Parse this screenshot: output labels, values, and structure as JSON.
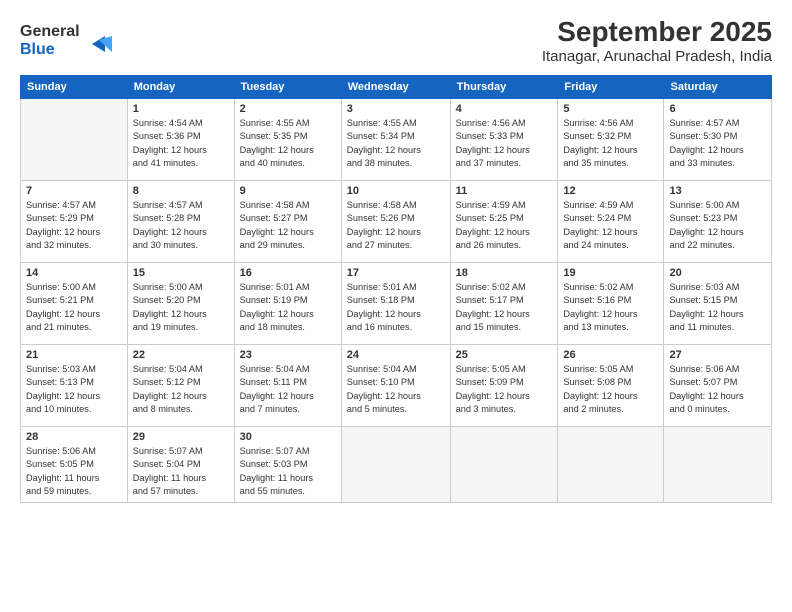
{
  "header": {
    "logo_line1": "General",
    "logo_line2": "Blue",
    "month": "September 2025",
    "location": "Itanagar, Arunachal Pradesh, India"
  },
  "days_of_week": [
    "Sunday",
    "Monday",
    "Tuesday",
    "Wednesday",
    "Thursday",
    "Friday",
    "Saturday"
  ],
  "weeks": [
    [
      {
        "num": "",
        "info": ""
      },
      {
        "num": "1",
        "info": "Sunrise: 4:54 AM\nSunset: 5:36 PM\nDaylight: 12 hours\nand 41 minutes."
      },
      {
        "num": "2",
        "info": "Sunrise: 4:55 AM\nSunset: 5:35 PM\nDaylight: 12 hours\nand 40 minutes."
      },
      {
        "num": "3",
        "info": "Sunrise: 4:55 AM\nSunset: 5:34 PM\nDaylight: 12 hours\nand 38 minutes."
      },
      {
        "num": "4",
        "info": "Sunrise: 4:56 AM\nSunset: 5:33 PM\nDaylight: 12 hours\nand 37 minutes."
      },
      {
        "num": "5",
        "info": "Sunrise: 4:56 AM\nSunset: 5:32 PM\nDaylight: 12 hours\nand 35 minutes."
      },
      {
        "num": "6",
        "info": "Sunrise: 4:57 AM\nSunset: 5:30 PM\nDaylight: 12 hours\nand 33 minutes."
      }
    ],
    [
      {
        "num": "7",
        "info": "Sunrise: 4:57 AM\nSunset: 5:29 PM\nDaylight: 12 hours\nand 32 minutes."
      },
      {
        "num": "8",
        "info": "Sunrise: 4:57 AM\nSunset: 5:28 PM\nDaylight: 12 hours\nand 30 minutes."
      },
      {
        "num": "9",
        "info": "Sunrise: 4:58 AM\nSunset: 5:27 PM\nDaylight: 12 hours\nand 29 minutes."
      },
      {
        "num": "10",
        "info": "Sunrise: 4:58 AM\nSunset: 5:26 PM\nDaylight: 12 hours\nand 27 minutes."
      },
      {
        "num": "11",
        "info": "Sunrise: 4:59 AM\nSunset: 5:25 PM\nDaylight: 12 hours\nand 26 minutes."
      },
      {
        "num": "12",
        "info": "Sunrise: 4:59 AM\nSunset: 5:24 PM\nDaylight: 12 hours\nand 24 minutes."
      },
      {
        "num": "13",
        "info": "Sunrise: 5:00 AM\nSunset: 5:23 PM\nDaylight: 12 hours\nand 22 minutes."
      }
    ],
    [
      {
        "num": "14",
        "info": "Sunrise: 5:00 AM\nSunset: 5:21 PM\nDaylight: 12 hours\nand 21 minutes."
      },
      {
        "num": "15",
        "info": "Sunrise: 5:00 AM\nSunset: 5:20 PM\nDaylight: 12 hours\nand 19 minutes."
      },
      {
        "num": "16",
        "info": "Sunrise: 5:01 AM\nSunset: 5:19 PM\nDaylight: 12 hours\nand 18 minutes."
      },
      {
        "num": "17",
        "info": "Sunrise: 5:01 AM\nSunset: 5:18 PM\nDaylight: 12 hours\nand 16 minutes."
      },
      {
        "num": "18",
        "info": "Sunrise: 5:02 AM\nSunset: 5:17 PM\nDaylight: 12 hours\nand 15 minutes."
      },
      {
        "num": "19",
        "info": "Sunrise: 5:02 AM\nSunset: 5:16 PM\nDaylight: 12 hours\nand 13 minutes."
      },
      {
        "num": "20",
        "info": "Sunrise: 5:03 AM\nSunset: 5:15 PM\nDaylight: 12 hours\nand 11 minutes."
      }
    ],
    [
      {
        "num": "21",
        "info": "Sunrise: 5:03 AM\nSunset: 5:13 PM\nDaylight: 12 hours\nand 10 minutes."
      },
      {
        "num": "22",
        "info": "Sunrise: 5:04 AM\nSunset: 5:12 PM\nDaylight: 12 hours\nand 8 minutes."
      },
      {
        "num": "23",
        "info": "Sunrise: 5:04 AM\nSunset: 5:11 PM\nDaylight: 12 hours\nand 7 minutes."
      },
      {
        "num": "24",
        "info": "Sunrise: 5:04 AM\nSunset: 5:10 PM\nDaylight: 12 hours\nand 5 minutes."
      },
      {
        "num": "25",
        "info": "Sunrise: 5:05 AM\nSunset: 5:09 PM\nDaylight: 12 hours\nand 3 minutes."
      },
      {
        "num": "26",
        "info": "Sunrise: 5:05 AM\nSunset: 5:08 PM\nDaylight: 12 hours\nand 2 minutes."
      },
      {
        "num": "27",
        "info": "Sunrise: 5:06 AM\nSunset: 5:07 PM\nDaylight: 12 hours\nand 0 minutes."
      }
    ],
    [
      {
        "num": "28",
        "info": "Sunrise: 5:06 AM\nSunset: 5:05 PM\nDaylight: 11 hours\nand 59 minutes."
      },
      {
        "num": "29",
        "info": "Sunrise: 5:07 AM\nSunset: 5:04 PM\nDaylight: 11 hours\nand 57 minutes."
      },
      {
        "num": "30",
        "info": "Sunrise: 5:07 AM\nSunset: 5:03 PM\nDaylight: 11 hours\nand 55 minutes."
      },
      {
        "num": "",
        "info": ""
      },
      {
        "num": "",
        "info": ""
      },
      {
        "num": "",
        "info": ""
      },
      {
        "num": "",
        "info": ""
      }
    ]
  ]
}
